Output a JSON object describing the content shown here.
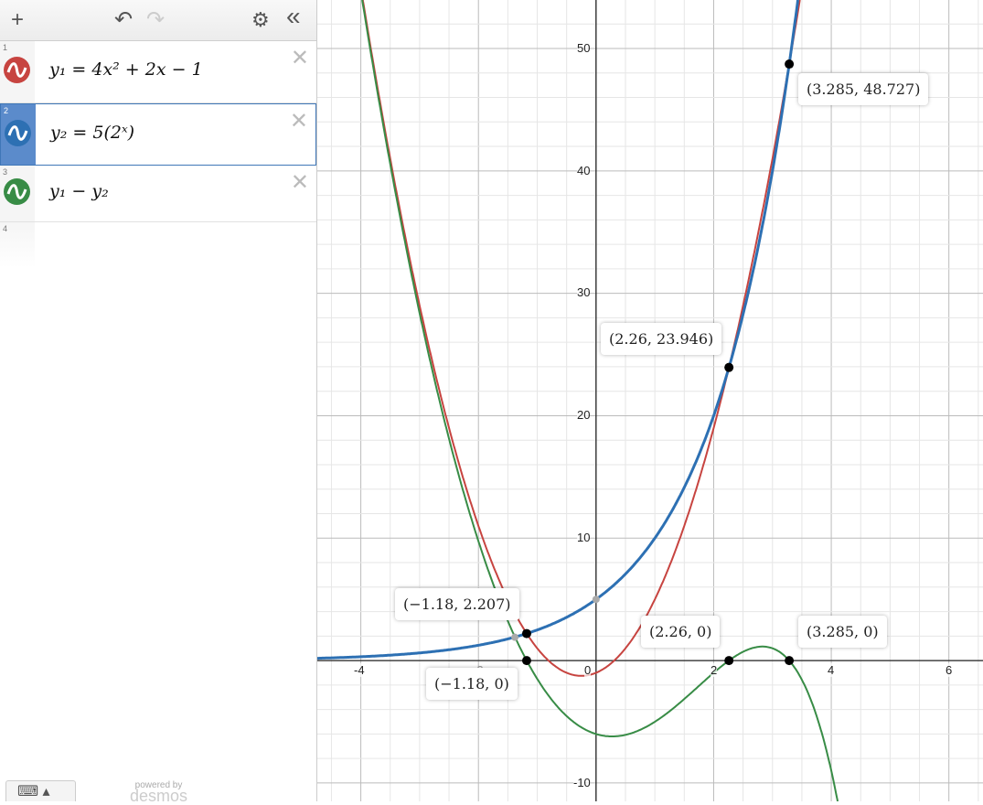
{
  "toolbar": {
    "add": "+",
    "undo": "↶",
    "redo": "↷",
    "settings": "⚙",
    "collapse": "«"
  },
  "expressions": [
    {
      "num": "1",
      "text": "y₁ = 4x² + 2x − 1",
      "color": "#c74440"
    },
    {
      "num": "2",
      "text": "y₂ = 5(2ˣ)",
      "color": "#2d70b3"
    },
    {
      "num": "3",
      "text": "y₁ − y₂",
      "color": "#388c46"
    },
    {
      "num": "4"
    }
  ],
  "delete_icon": "✕",
  "keyboard": "⌨ ▴",
  "powered": {
    "line1": "powered by",
    "line2": "desmos"
  },
  "graph": {
    "x_range": [
      -4.74,
      6.58
    ],
    "y_range": [
      -11.5,
      53.96
    ],
    "x_ticks": [
      "-4",
      "-2",
      "0",
      "2",
      "4",
      "6"
    ],
    "y_ticks": [
      "10",
      "20",
      "30",
      "40",
      "50",
      "-10"
    ],
    "points": [
      {
        "x": -1.18,
        "y": 2.207,
        "label": "(−1.18, 2.207)"
      },
      {
        "x": -1.18,
        "y": 0,
        "label": "(−1.18, 0)"
      },
      {
        "x": 2.26,
        "y": 23.946,
        "label": "(2.26, 23.946)"
      },
      {
        "x": 2.26,
        "y": 0,
        "label": "(2.26, 0)"
      },
      {
        "x": 3.285,
        "y": 48.727,
        "label": "(3.285, 48.727)"
      },
      {
        "x": 3.285,
        "y": 0,
        "label": "(3.285, 0)"
      }
    ],
    "gray_points": [
      {
        "x": 0,
        "y": 5
      },
      {
        "x": -1.38,
        "y": 1.9
      }
    ]
  }
}
